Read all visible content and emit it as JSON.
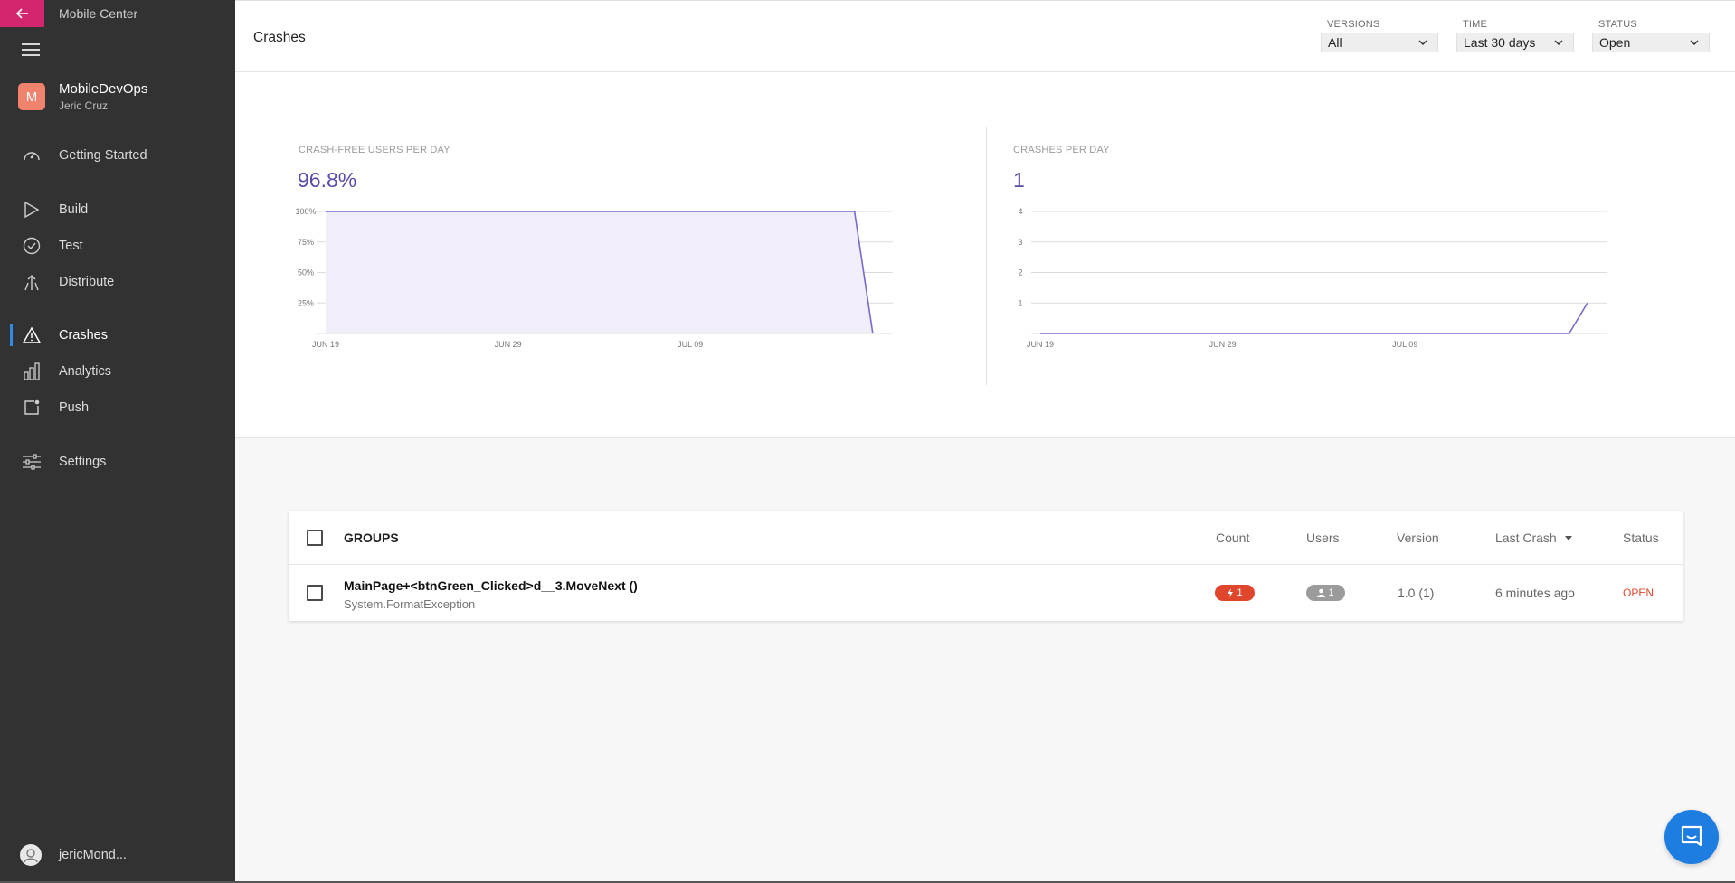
{
  "app": {
    "name": "Mobile Center"
  },
  "org": {
    "initial": "M",
    "name": "MobileDevOps",
    "user": "Jeric Cruz"
  },
  "nav": {
    "items": [
      {
        "label": "Getting Started",
        "icon": "gauge-icon"
      },
      {
        "label": "Build",
        "icon": "play-icon"
      },
      {
        "label": "Test",
        "icon": "check-circle-icon"
      },
      {
        "label": "Distribute",
        "icon": "distribute-icon"
      },
      {
        "label": "Crashes",
        "icon": "warning-icon",
        "active": true
      },
      {
        "label": "Analytics",
        "icon": "bar-chart-icon"
      },
      {
        "label": "Push",
        "icon": "push-icon"
      },
      {
        "label": "Settings",
        "icon": "sliders-icon"
      }
    ]
  },
  "account": {
    "name": "jericMond..."
  },
  "header": {
    "title": "Crashes",
    "filters": [
      {
        "label": "VERSIONS",
        "value": "All"
      },
      {
        "label": "TIME",
        "value": "Last 30 days"
      },
      {
        "label": "STATUS",
        "value": "Open"
      }
    ]
  },
  "chart_data": [
    {
      "type": "area",
      "title": "CRASH-FREE USERS PER DAY",
      "headline": "96.8%",
      "x_ticks": [
        "JUN 19",
        "JUN 29",
        "JUL 09"
      ],
      "y_ticks": [
        "25%",
        "50%",
        "75%",
        "100%"
      ],
      "ylim": [
        0,
        100
      ],
      "x": [
        0,
        29,
        30
      ],
      "values": [
        100,
        100,
        0
      ],
      "color": "#7b68c8",
      "fill": "#f1eefa"
    },
    {
      "type": "line",
      "title": "CRASHES PER DAY",
      "headline": "1",
      "x_ticks": [
        "JUN 19",
        "JUN 29",
        "JUL 09"
      ],
      "y_ticks": [
        "1",
        "2",
        "3",
        "4"
      ],
      "ylim": [
        0,
        4
      ],
      "x": [
        0,
        29,
        30
      ],
      "values": [
        0,
        0,
        1
      ],
      "color": "#7b68c8"
    }
  ],
  "groups": {
    "header": "GROUPS",
    "columns": [
      "Count",
      "Users",
      "Version",
      "Last Crash",
      "Status"
    ],
    "rows": [
      {
        "title": "MainPage+<btnGreen_Clicked>d__3.MoveNext ()",
        "subtitle": "System.FormatException",
        "count": "1",
        "users": "1",
        "version": "1.0 (1)",
        "last_crash": "6 minutes ago",
        "status": "OPEN"
      }
    ]
  },
  "colors": {
    "accent": "#d4266f",
    "sidebar": "#323232",
    "chart": "#7b68c8",
    "crash": "#e0462c",
    "chat": "#1d7de0"
  }
}
